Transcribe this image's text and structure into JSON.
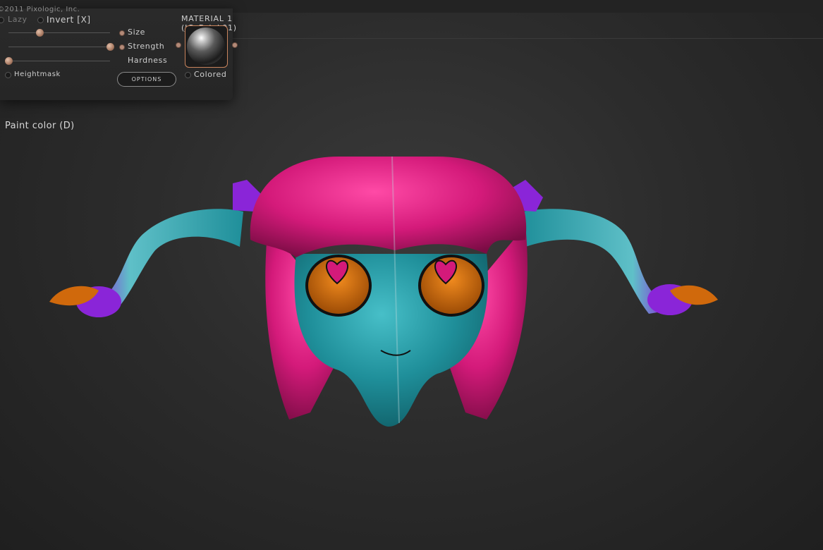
{
  "topbar": {
    "copyright": "©2011 Pixologic, Inc."
  },
  "brush": {
    "lazy_label": "Lazy",
    "invert_label": "Invert [X]",
    "size_label": "Size",
    "strength_label": "Strength",
    "hardness_label": "Hardness",
    "heightmask_label": "Heightmask",
    "options_label": "OPTIONS",
    "size_level": 0.3,
    "strength_level": 1.0,
    "hardness_level": 0.0
  },
  "material": {
    "title": "MATERIAL 1 (JG_Drink01)",
    "colored_label": "Colored"
  },
  "canvas": {
    "paint_color_label": "Paint color (D)"
  },
  "colors": {
    "hair": "#d41a7a",
    "skin": "#1f8f9a",
    "eyes": "#d0690c",
    "tips": "#8a25d8",
    "accent": "#c9845d"
  }
}
